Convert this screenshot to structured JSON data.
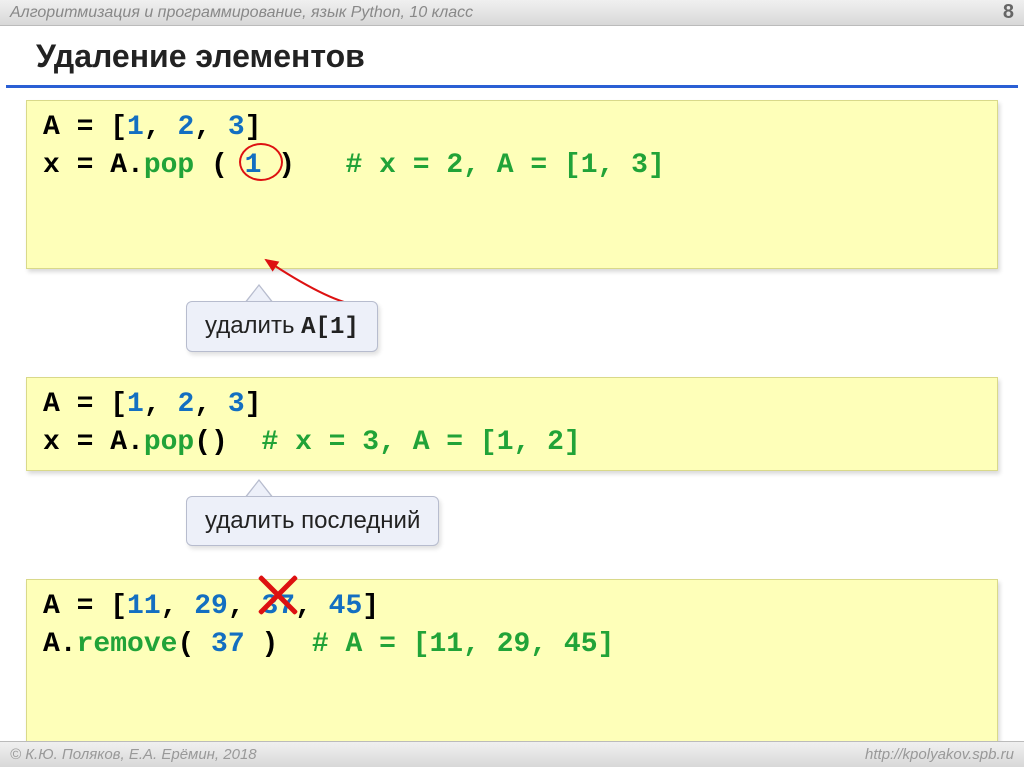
{
  "header": {
    "course": "Алгоритмизация и программирование, язык Python, 10 класс",
    "page": "8"
  },
  "title": "Удаление элементов",
  "block1": {
    "line1_pre": "A = [",
    "line1_n1": "1",
    "line1_s1": ", ",
    "line1_n2": "2",
    "line1_s2": ", ",
    "line1_n3": "3",
    "line1_post": "]",
    "line2_pre": "x = A.",
    "line2_method": "pop",
    "line2_open": " ( ",
    "line2_arg": "1",
    "line2_close": " )   ",
    "line2_comment": "# x = 2, A = [1, 3]"
  },
  "callout1_text_pre": "удалить ",
  "callout1_code": "A[1]",
  "block2": {
    "line1_pre": "A = [",
    "line1_n1": "1",
    "line1_s1": ", ",
    "line1_n2": "2",
    "line1_s2": ", ",
    "line1_n3": "3",
    "line1_post": "]",
    "line2_pre": "x = A.",
    "line2_method": "pop",
    "line2_rest": "()  ",
    "line2_comment": "# x = 3, A = [1, 2]"
  },
  "callout2_text": "удалить последний",
  "block3": {
    "line1_pre": "A = [",
    "line1_n1": "11",
    "line1_s1": ", ",
    "line1_n2": "29",
    "line1_s2": ", ",
    "line1_n3": "37",
    "line1_s3": ", ",
    "line1_n4": "45",
    "line1_post": "]",
    "line2_pre": "A.",
    "line2_method": "remove",
    "line2_open": "( ",
    "line2_arg": "37",
    "line2_close": " )  ",
    "line2_comment": "# A = [11, 29, 45]"
  },
  "footer": {
    "copyright": "© К.Ю. Поляков, Е.А. Ерёмин, 2018",
    "url": "http://kpolyakov.spb.ru"
  }
}
